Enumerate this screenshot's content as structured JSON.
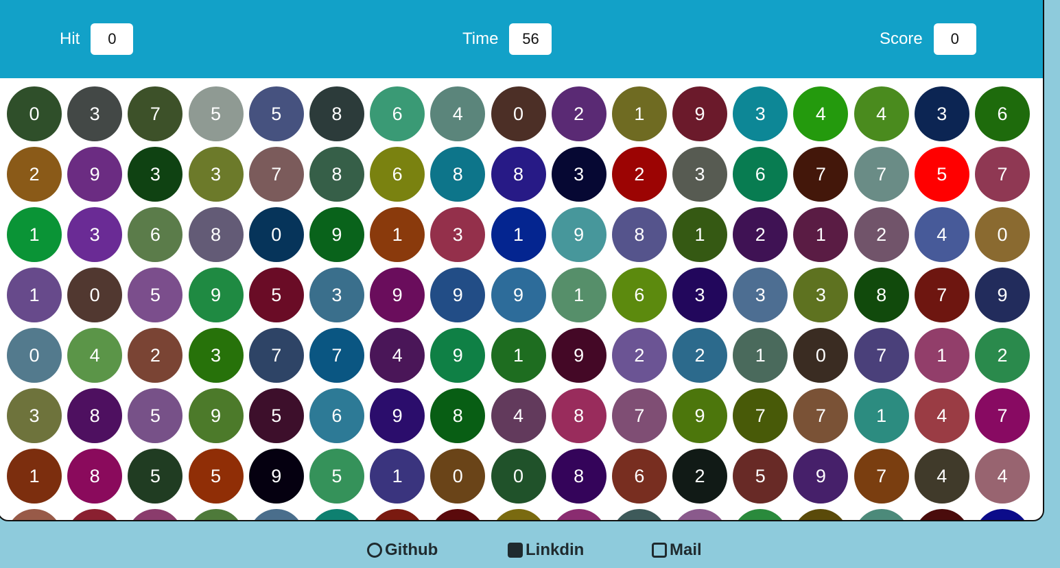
{
  "header": {
    "hit_label": "Hit",
    "hit_value": "0",
    "time_label": "Time",
    "time_value": "56",
    "score_label": "Score",
    "score_value": "0",
    "bg_color": "#12a1c8"
  },
  "board": {
    "rows": [
      [
        [
          "0",
          "#2f4f2a"
        ],
        [
          "3",
          "#434846"
        ],
        [
          "7",
          "#3d5129"
        ],
        [
          "5",
          "#8f9a93"
        ],
        [
          "5",
          "#46527f"
        ],
        [
          "8",
          "#2c3b3a"
        ],
        [
          "6",
          "#3a9a75"
        ],
        [
          "4",
          "#5b857b"
        ],
        [
          "0",
          "#4c2f26"
        ],
        [
          "2",
          "#5a2a74"
        ],
        [
          "1",
          "#6f6b22"
        ],
        [
          "9",
          "#6b1a2b"
        ],
        [
          "3",
          "#0d8796"
        ],
        [
          "4",
          "#249a0d"
        ],
        [
          "4",
          "#4a8b1e"
        ],
        [
          "3",
          "#0c2553"
        ],
        [
          "6",
          "#1e6b0c"
        ]
      ],
      [
        [
          "2",
          "#8a5a18"
        ],
        [
          "9",
          "#6b2c82"
        ],
        [
          "3",
          "#0f4212"
        ],
        [
          "3",
          "#6c7a2a"
        ],
        [
          "7",
          "#7b5b5b"
        ],
        [
          "8",
          "#365f48"
        ],
        [
          "6",
          "#7a8210"
        ],
        [
          "8",
          "#0d758a"
        ],
        [
          "8",
          "#271a86"
        ],
        [
          "3",
          "#060833"
        ],
        [
          "2",
          "#9c0403"
        ],
        [
          "3",
          "#575b52"
        ],
        [
          "6",
          "#087c51"
        ],
        [
          "7",
          "#43170a"
        ],
        [
          "7",
          "#6a8c86"
        ],
        [
          "5",
          "#ff0000"
        ],
        [
          "7",
          "#8f3853"
        ]
      ],
      [
        [
          "1",
          "#0a9436"
        ],
        [
          "3",
          "#6a2b95"
        ],
        [
          "6",
          "#5b7c4a"
        ],
        [
          "8",
          "#635b76"
        ],
        [
          "0",
          "#06345a"
        ],
        [
          "9",
          "#09631b"
        ],
        [
          "1",
          "#8a3a0c"
        ],
        [
          "3",
          "#94304b"
        ],
        [
          "1",
          "#042590"
        ],
        [
          "9",
          "#47979b"
        ],
        [
          "8",
          "#55548c"
        ],
        [
          "1",
          "#355913"
        ],
        [
          "2",
          "#3f1254"
        ],
        [
          "1",
          "#5a1c44"
        ],
        [
          "2",
          "#71546a"
        ],
        [
          "4",
          "#475a99"
        ],
        [
          "0",
          "#8a6a30"
        ]
      ],
      [
        [
          "1",
          "#674a8b"
        ],
        [
          "0",
          "#513830"
        ],
        [
          "5",
          "#7b4e8c"
        ],
        [
          "9",
          "#1f8a42"
        ],
        [
          "5",
          "#6a0c26"
        ],
        [
          "3",
          "#3a6f8c"
        ],
        [
          "9",
          "#6a0d5c"
        ],
        [
          "9",
          "#224d86"
        ],
        [
          "9",
          "#2d6c9a"
        ],
        [
          "1",
          "#568f6a"
        ],
        [
          "6",
          "#5c8a0e"
        ],
        [
          "3",
          "#22075c"
        ],
        [
          "3",
          "#4d6e92"
        ],
        [
          "3",
          "#5e7220"
        ],
        [
          "8",
          "#114a0c"
        ],
        [
          "7",
          "#6e1610"
        ],
        [
          "9",
          "#222c5c"
        ]
      ],
      [
        [
          "0",
          "#537a8d"
        ],
        [
          "4",
          "#5b9548"
        ],
        [
          "2",
          "#7a4434"
        ],
        [
          "3",
          "#27720a"
        ],
        [
          "7",
          "#2e4466"
        ],
        [
          "7",
          "#0a5682"
        ],
        [
          "4",
          "#4a1658"
        ],
        [
          "9",
          "#0f8045"
        ],
        [
          "1",
          "#1e6d20"
        ],
        [
          "9",
          "#440826"
        ],
        [
          "2",
          "#6b5494"
        ],
        [
          "2",
          "#2c6a8c"
        ],
        [
          "1",
          "#4a6a5c"
        ],
        [
          "0",
          "#3a2c22"
        ],
        [
          "7",
          "#4a407a"
        ],
        [
          "1",
          "#923e6a"
        ],
        [
          "2",
          "#2a8a4c"
        ]
      ],
      [
        [
          "3",
          "#6e733c"
        ],
        [
          "8",
          "#4e1060"
        ],
        [
          "5",
          "#775188"
        ],
        [
          "9",
          "#4c7a2a"
        ],
        [
          "5",
          "#3d0f2b"
        ],
        [
          "6",
          "#2d7a96"
        ],
        [
          "9",
          "#2b0d6c"
        ],
        [
          "8",
          "#085e14"
        ],
        [
          "4",
          "#623a5c"
        ],
        [
          "8",
          "#992c5c"
        ],
        [
          "7",
          "#7f4e74"
        ],
        [
          "9",
          "#4c760c"
        ],
        [
          "7",
          "#485a08"
        ],
        [
          "7",
          "#7a5236"
        ],
        [
          "1",
          "#2c8c80"
        ],
        [
          "4",
          "#9a3c44"
        ],
        [
          "7",
          "#880a62"
        ]
      ],
      [
        [
          "1",
          "#7c2e0e"
        ],
        [
          "8",
          "#8a0a5c"
        ],
        [
          "5",
          "#203c22"
        ],
        [
          "5",
          "#902e06"
        ],
        [
          "9",
          "#050010"
        ],
        [
          "5",
          "#35925a"
        ],
        [
          "1",
          "#3a347e"
        ],
        [
          "0",
          "#6a4418"
        ],
        [
          "0",
          "#20522a"
        ],
        [
          "8",
          "#34045a"
        ],
        [
          "6",
          "#782e20"
        ],
        [
          "2",
          "#111a16"
        ],
        [
          "5",
          "#682a26"
        ],
        [
          "9",
          "#46206a"
        ],
        [
          "7",
          "#7a3e10"
        ],
        [
          "4",
          "#403a2a"
        ],
        [
          "4",
          "#986470"
        ]
      ],
      [
        [
          "",
          "#985a48"
        ],
        [
          "",
          "#8a2030"
        ],
        [
          "",
          "#8a3c6c"
        ],
        [
          "",
          "#4e7a3a"
        ],
        [
          "",
          "#4a6e8c"
        ],
        [
          "",
          "#0e8070"
        ],
        [
          "",
          "#7a1a10"
        ],
        [
          "",
          "#5a0a0c"
        ],
        [
          "",
          "#7a6a10"
        ],
        [
          "",
          "#8a2c70"
        ],
        [
          "",
          "#3e5a5a"
        ],
        [
          "",
          "#8a5a8c"
        ],
        [
          "",
          "#2a8a3c"
        ],
        [
          "",
          "#5a4a0a"
        ],
        [
          "",
          "#4c8a7a"
        ],
        [
          "",
          "#4a0c0c"
        ],
        [
          "",
          "#0c0c8a"
        ]
      ]
    ]
  },
  "footer": {
    "github_label": "Github",
    "linkedin_label": "Linkdin",
    "mail_label": "Mail"
  }
}
